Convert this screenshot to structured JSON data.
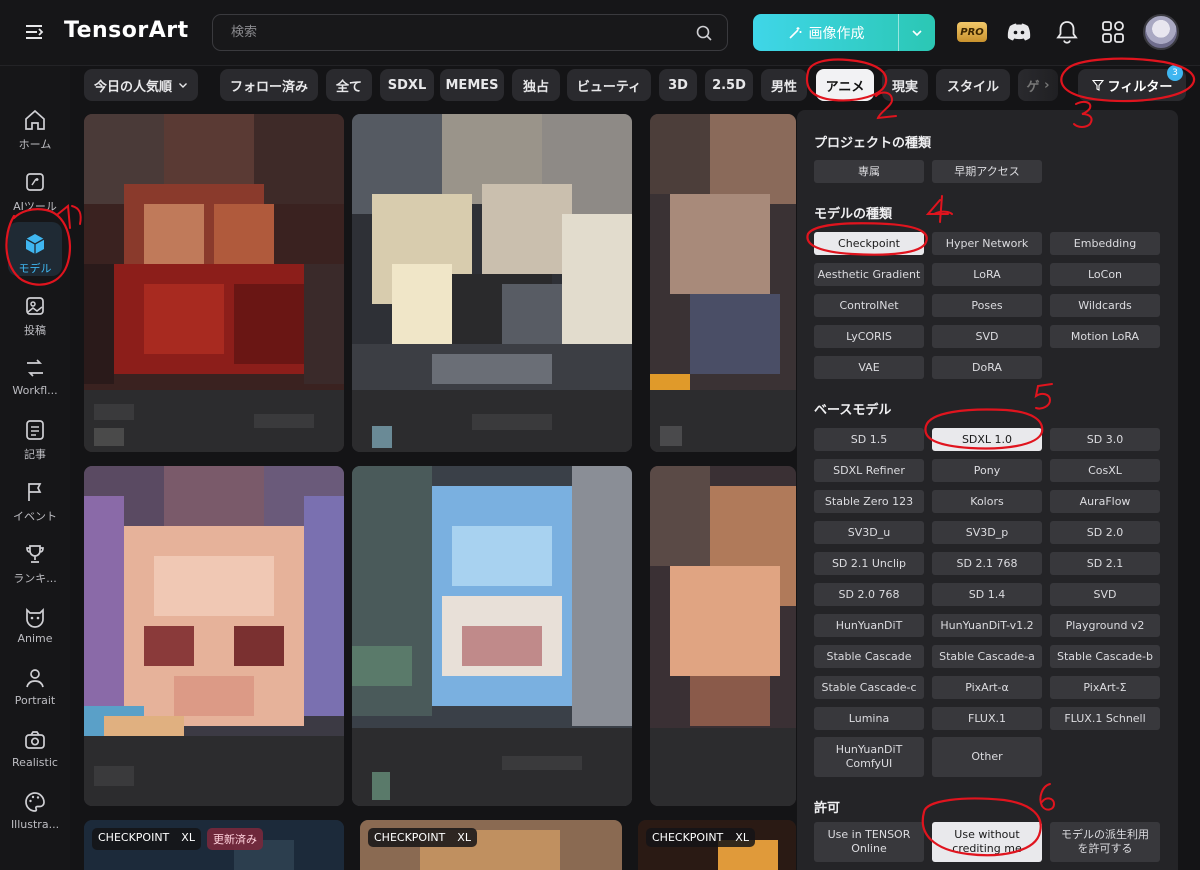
{
  "header": {
    "logo": "TensorArt",
    "search_placeholder": "検索",
    "create_label": "画像作成",
    "pro_label": "PRO"
  },
  "sidebar": {
    "items": [
      {
        "label": "ホーム",
        "icon": "home-icon"
      },
      {
        "label": "AIツール",
        "icon": "ai-tools-icon"
      },
      {
        "label": "モデル",
        "icon": "model-cube-icon",
        "active": true
      },
      {
        "label": "投稿",
        "icon": "image-post-icon"
      },
      {
        "label": "Workfl...",
        "icon": "workflow-icon"
      },
      {
        "label": "記事",
        "icon": "article-icon"
      },
      {
        "label": "イベント",
        "icon": "flag-icon"
      },
      {
        "label": "ランキ...",
        "icon": "trophy-icon"
      },
      {
        "label": "Anime",
        "icon": "anime-face-icon"
      },
      {
        "label": "Portrait",
        "icon": "person-icon"
      },
      {
        "label": "Realistic",
        "icon": "camera-icon"
      },
      {
        "label": "Illustra...",
        "icon": "palette-icon"
      }
    ]
  },
  "filters": {
    "sort": "今日の人気順",
    "chips": [
      "フォロー済み",
      "全て",
      "SDXL",
      "MEMES",
      "独占",
      "ビューティ",
      "3D",
      "2.5D",
      "男性",
      "アニメ",
      "現実",
      "スタイル",
      "ゲ"
    ],
    "active_chip": "アニメ",
    "filter_button": "フィルター",
    "filter_count": "3"
  },
  "cards": {
    "tags": [
      {
        "type": "CHECKPOINT",
        "base": "XL",
        "extra": "更新済み"
      },
      {
        "type": "CHECKPOINT",
        "base": "XL",
        "extra": ""
      },
      {
        "type": "CHECKPOINT",
        "base": "XL",
        "extra": ""
      }
    ]
  },
  "panel": {
    "project_type": {
      "title": "プロジェクトの種類",
      "options": [
        "専属",
        "早期アクセス"
      ]
    },
    "model_type": {
      "title": "モデルの種類",
      "options": [
        "Checkpoint",
        "Hyper Network",
        "Embedding",
        "Aesthetic Gradient",
        "LoRA",
        "LoCon",
        "ControlNet",
        "Poses",
        "Wildcards",
        "LyCORIS",
        "SVD",
        "Motion LoRA",
        "VAE",
        "DoRA"
      ],
      "selected": "Checkpoint"
    },
    "base_model": {
      "title": "ベースモデル",
      "options": [
        "SD 1.5",
        "SDXL 1.0",
        "SD 3.0",
        "SDXL Refiner",
        "Pony",
        "CosXL",
        "Stable Zero 123",
        "Kolors",
        "AuraFlow",
        "SV3D_u",
        "SV3D_p",
        "SD 2.0",
        "SD 2.1 Unclip",
        "SD 2.1 768",
        "SD 2.1",
        "SD 2.0 768",
        "SD 1.4",
        "SVD",
        "HunYuanDiT",
        "HunYuanDiT-v1.2",
        "Playground v2",
        "Stable Cascade",
        "Stable Cascade-a",
        "Stable Cascade-b",
        "Stable Cascade-c",
        "PixArt-α",
        "PixArt-Σ",
        "Lumina",
        "FLUX.1",
        "FLUX.1 Schnell",
        "HunYuanDiT ComfyUI",
        "Other"
      ],
      "selected": "SDXL 1.0"
    },
    "license": {
      "title": "許可",
      "options": [
        "Use in TENSOR Online",
        "Use without crediting me",
        "モデルの派生利用を許可する"
      ],
      "selected": "Use without crediting me"
    }
  },
  "annotations": [
    "1",
    "2",
    "3",
    "4",
    "5",
    "6"
  ],
  "colors": {
    "accent": "#3fb6f0",
    "create_gradient_start": "#3fd6e8",
    "annotation": "#e0141e"
  }
}
